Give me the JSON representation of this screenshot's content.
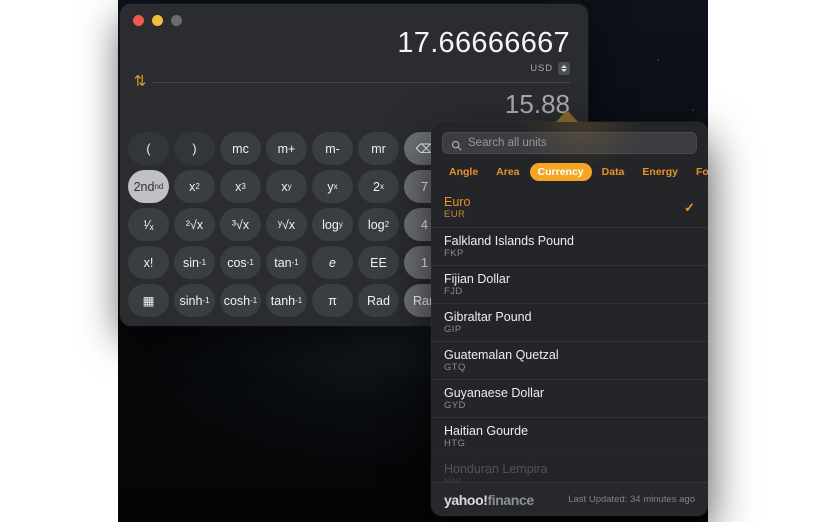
{
  "window": {
    "traffic_lights": [
      "close",
      "minimize",
      "zoom"
    ]
  },
  "display": {
    "primary_value": "17.66666667",
    "primary_unit": "USD",
    "secondary_value": "15.88",
    "secondary_unit": "EUR",
    "swap_icon": "swap-vertical-arrows-icon"
  },
  "keypad": {
    "rows": [
      [
        {
          "label": "(",
          "style": "paren"
        },
        {
          "label": ")",
          "style": "paren"
        },
        {
          "label": "mc",
          "style": "normal"
        },
        {
          "label": "m+",
          "style": "normal"
        },
        {
          "label": "m-",
          "style": "normal"
        },
        {
          "label": "mr",
          "style": "normal"
        },
        {
          "label": "⌫",
          "style": "light"
        }
      ],
      [
        {
          "label": "2nd",
          "style": "active",
          "sup": "nd"
        },
        {
          "label": "x",
          "style": "normal",
          "sup": "2"
        },
        {
          "label": "x",
          "style": "normal",
          "sup": "3"
        },
        {
          "label": "x",
          "style": "normal",
          "sup": "y"
        },
        {
          "label": "y",
          "style": "normal",
          "sup": "x"
        },
        {
          "label": "2",
          "style": "normal",
          "sup": "x"
        },
        {
          "label": "7",
          "style": "light"
        }
      ],
      [
        {
          "label": "¹⁄ₓ",
          "style": "normal"
        },
        {
          "label": "²√x",
          "style": "normal"
        },
        {
          "label": "³√x",
          "style": "normal"
        },
        {
          "label": "ʸ√x",
          "style": "normal"
        },
        {
          "label": "log",
          "style": "normal",
          "sub": "y"
        },
        {
          "label": "log",
          "style": "normal",
          "sub": "2"
        },
        {
          "label": "4",
          "style": "light"
        }
      ],
      [
        {
          "label": "x!",
          "style": "normal"
        },
        {
          "label": "sin",
          "style": "normal",
          "sup": "-1"
        },
        {
          "label": "cos",
          "style": "normal",
          "sup": "-1"
        },
        {
          "label": "tan",
          "style": "normal",
          "sup": "-1"
        },
        {
          "label": "e",
          "style": "normal",
          "italic": true
        },
        {
          "label": "EE",
          "style": "normal"
        },
        {
          "label": "1",
          "style": "light"
        }
      ],
      [
        {
          "label": "▦",
          "style": "normal"
        },
        {
          "label": "sinh",
          "style": "normal",
          "sup": "-1"
        },
        {
          "label": "cosh",
          "style": "normal",
          "sup": "-1"
        },
        {
          "label": "tanh",
          "style": "normal",
          "sup": "-1"
        },
        {
          "label": "π",
          "style": "normal"
        },
        {
          "label": "Rad",
          "style": "normal"
        },
        {
          "label": "Ran",
          "style": "light"
        }
      ]
    ]
  },
  "picker": {
    "search": {
      "placeholder": "Search all units",
      "value": "",
      "icon": "search-icon"
    },
    "tabs": [
      {
        "label": "Angle",
        "active": false
      },
      {
        "label": "Area",
        "active": false
      },
      {
        "label": "Currency",
        "active": true
      },
      {
        "label": "Data",
        "active": false
      },
      {
        "label": "Energy",
        "active": false
      },
      {
        "label": "Force",
        "active": false
      }
    ],
    "units": [
      {
        "name": "Euro",
        "code": "EUR",
        "selected": true,
        "faded": false
      },
      {
        "name": "Falkland Islands Pound",
        "code": "FKP",
        "selected": false,
        "faded": false
      },
      {
        "name": "Fijian Dollar",
        "code": "FJD",
        "selected": false,
        "faded": false
      },
      {
        "name": "Gibraltar Pound",
        "code": "GIP",
        "selected": false,
        "faded": false
      },
      {
        "name": "Guatemalan Quetzal",
        "code": "GTQ",
        "selected": false,
        "faded": false
      },
      {
        "name": "Guyanaese Dollar",
        "code": "GYD",
        "selected": false,
        "faded": false
      },
      {
        "name": "Haitian Gourde",
        "code": "HTG",
        "selected": false,
        "faded": false
      },
      {
        "name": "Honduran Lempira",
        "code": "HNL",
        "selected": false,
        "faded": true
      }
    ],
    "check_glyph": "✓",
    "footer": {
      "brand_yahoo": "yahoo",
      "brand_bang": "!",
      "brand_finance": "finance",
      "updated": "Last Updated: 34 minutes ago"
    }
  },
  "colors": {
    "accent_orange": "#f5a623",
    "tab_orange": "#e8922a",
    "panel_bg": "#232528",
    "calc_bg": "#2a2c30",
    "key_bg": "#3a3d42",
    "key_light": "#6d7076",
    "traffic_red": "#eb5b4d",
    "traffic_yellow": "#f2bd40",
    "traffic_gray": "#6a6c70"
  }
}
